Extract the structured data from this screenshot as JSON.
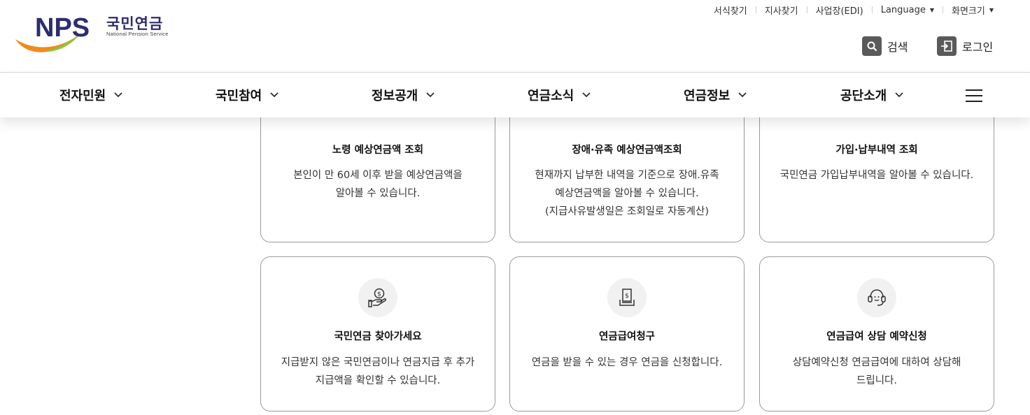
{
  "header": {
    "logo": {
      "mark": "NPS",
      "name_kr": "국민연금",
      "name_en": "National Pension Service"
    },
    "utility": [
      {
        "label": "서식찾기"
      },
      {
        "label": "지사찾기"
      },
      {
        "label": "사업장(EDI)"
      },
      {
        "label": "Language"
      },
      {
        "label": "화면크기"
      }
    ],
    "search_label": "검색",
    "login_label": "로그인"
  },
  "nav": {
    "menus": [
      {
        "label": "전자민원"
      },
      {
        "label": "국민참여"
      },
      {
        "label": "정보공개"
      },
      {
        "label": "연금소식"
      },
      {
        "label": "연금정보"
      },
      {
        "label": "공단소개"
      }
    ]
  },
  "cards": [
    {
      "title": "노령 예상연금액 조회",
      "desc": [
        "본인이 만 60세 이후 받을 예상연금액을",
        "알아볼 수 있습니다."
      ]
    },
    {
      "title": "장애·유족 예상연금액조회",
      "desc": [
        "현재까지 납부한 내역을 기준으로 장애.유족",
        "예상연금액을 알아볼 수 있습니다.",
        "(지급사유발생일은 조회일로 자동계산)"
      ]
    },
    {
      "title": "가입·납부내역 조회",
      "desc": [
        "국민연금 가입납부내역을 알아볼 수 있습니다."
      ]
    },
    {
      "title": "국민연금 찾아가세요",
      "icon": "hand-coin-icon",
      "desc": [
        "지급받지 않은 국민연금이나 연금지급 후 추가",
        "지급액을 확인할 수 있습니다."
      ]
    },
    {
      "title": "연금급여청구",
      "icon": "document-tray-icon",
      "desc": [
        "연금을 받을 수 있는 경우 연금을 신청합니다."
      ]
    },
    {
      "title": "연금급여 상담 예약신청",
      "icon": "headset-icon",
      "desc": [
        "상담예약신청 연금급여에 대하여 상담해",
        "드립니다."
      ]
    }
  ],
  "colors": {
    "brand_navy": "#2b2d6e",
    "brand_orange": "#f08a1c",
    "brand_green": "#8cc63f",
    "border": "#9a9a9a"
  }
}
